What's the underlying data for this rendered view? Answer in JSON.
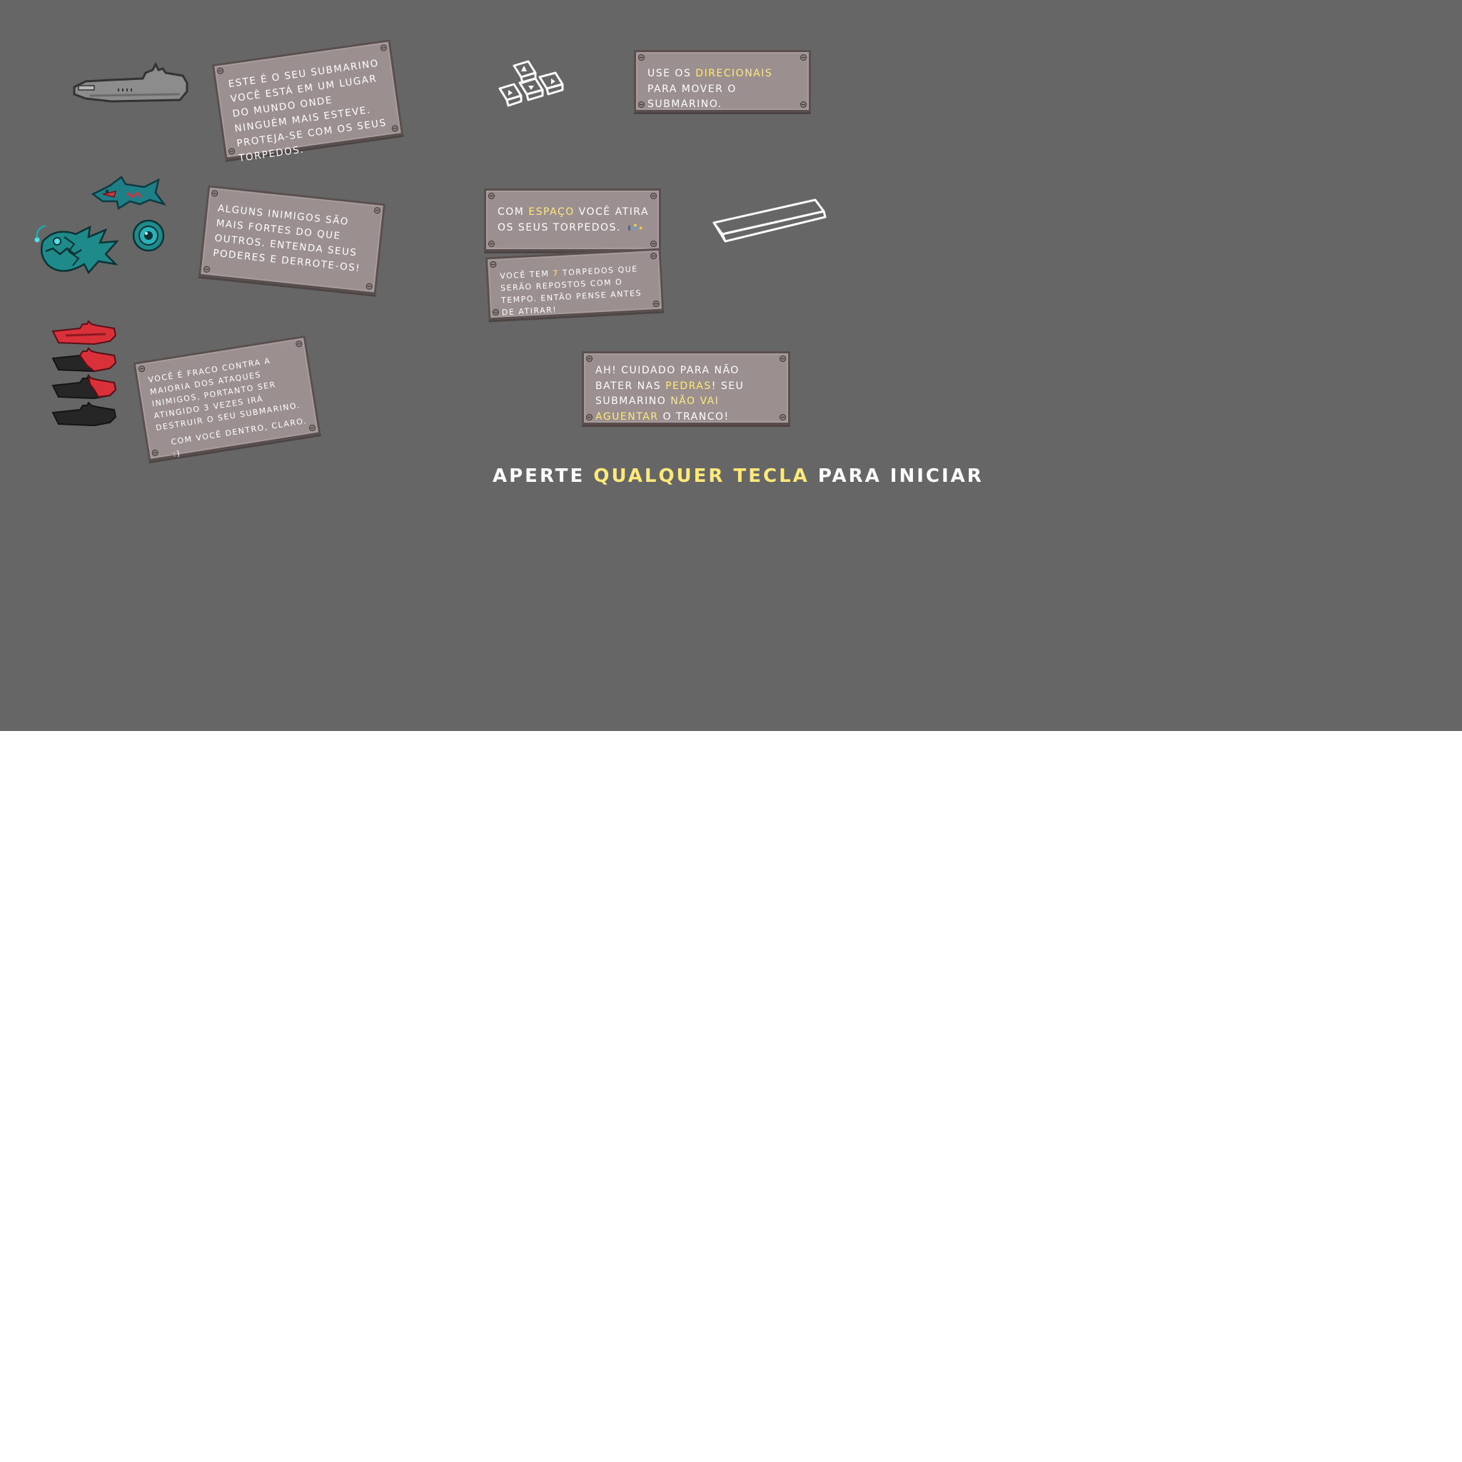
{
  "panels": {
    "submarine": {
      "text": "Este é o seu submarino você está em um lugar do mundo onde ninguém mais esteve. Proteja-se com os seus torpedos."
    },
    "arrows": {
      "pre": "Use os ",
      "highlight": "direcionais",
      "post": " para mover o submarino."
    },
    "enemies": {
      "text": "Alguns inimigos são mais fortes do que outros. Entenda seus poderes e derrote-os!"
    },
    "space": {
      "pre": "Com ",
      "highlight": "espaço",
      "post": " você atira os seus torpedos."
    },
    "torpedoes": {
      "pre": "Você tem ",
      "highlight": "7",
      "post": " torpedos que serão repostos com o tempo. Então pense antes de atirar!"
    },
    "health": {
      "text": "Você é fraco contra a maioria dos ataques inimigos, portanto ser atingido 3 vezes irá destruir o seu submarino.",
      "footer": "Com você dentro, claro. :)"
    },
    "rocks": {
      "pre": "Ah! Cuidado para não bater nas ",
      "highlight1": "pedras",
      "mid": "! Seu submarino ",
      "highlight2": "não vai aguentar",
      "post": " o tranco!"
    }
  },
  "start_prompt": {
    "pre": "Aperte ",
    "highlight": "qualquer tecla",
    "post": " para iniciar"
  },
  "colors": {
    "background": "#666666",
    "plate": "#9c8f8f",
    "highlight": "#ffe97a",
    "enemy": "#1f8a8a",
    "life_full": "#d9303a",
    "life_empty": "#262626"
  },
  "icons": [
    "submarine-sprite",
    "arrow-keys-icon",
    "spacebar-icon",
    "shark-enemy",
    "anglerfish-enemy",
    "eyeball-enemy",
    "torpedo-icon",
    "life-submarine-icon"
  ]
}
